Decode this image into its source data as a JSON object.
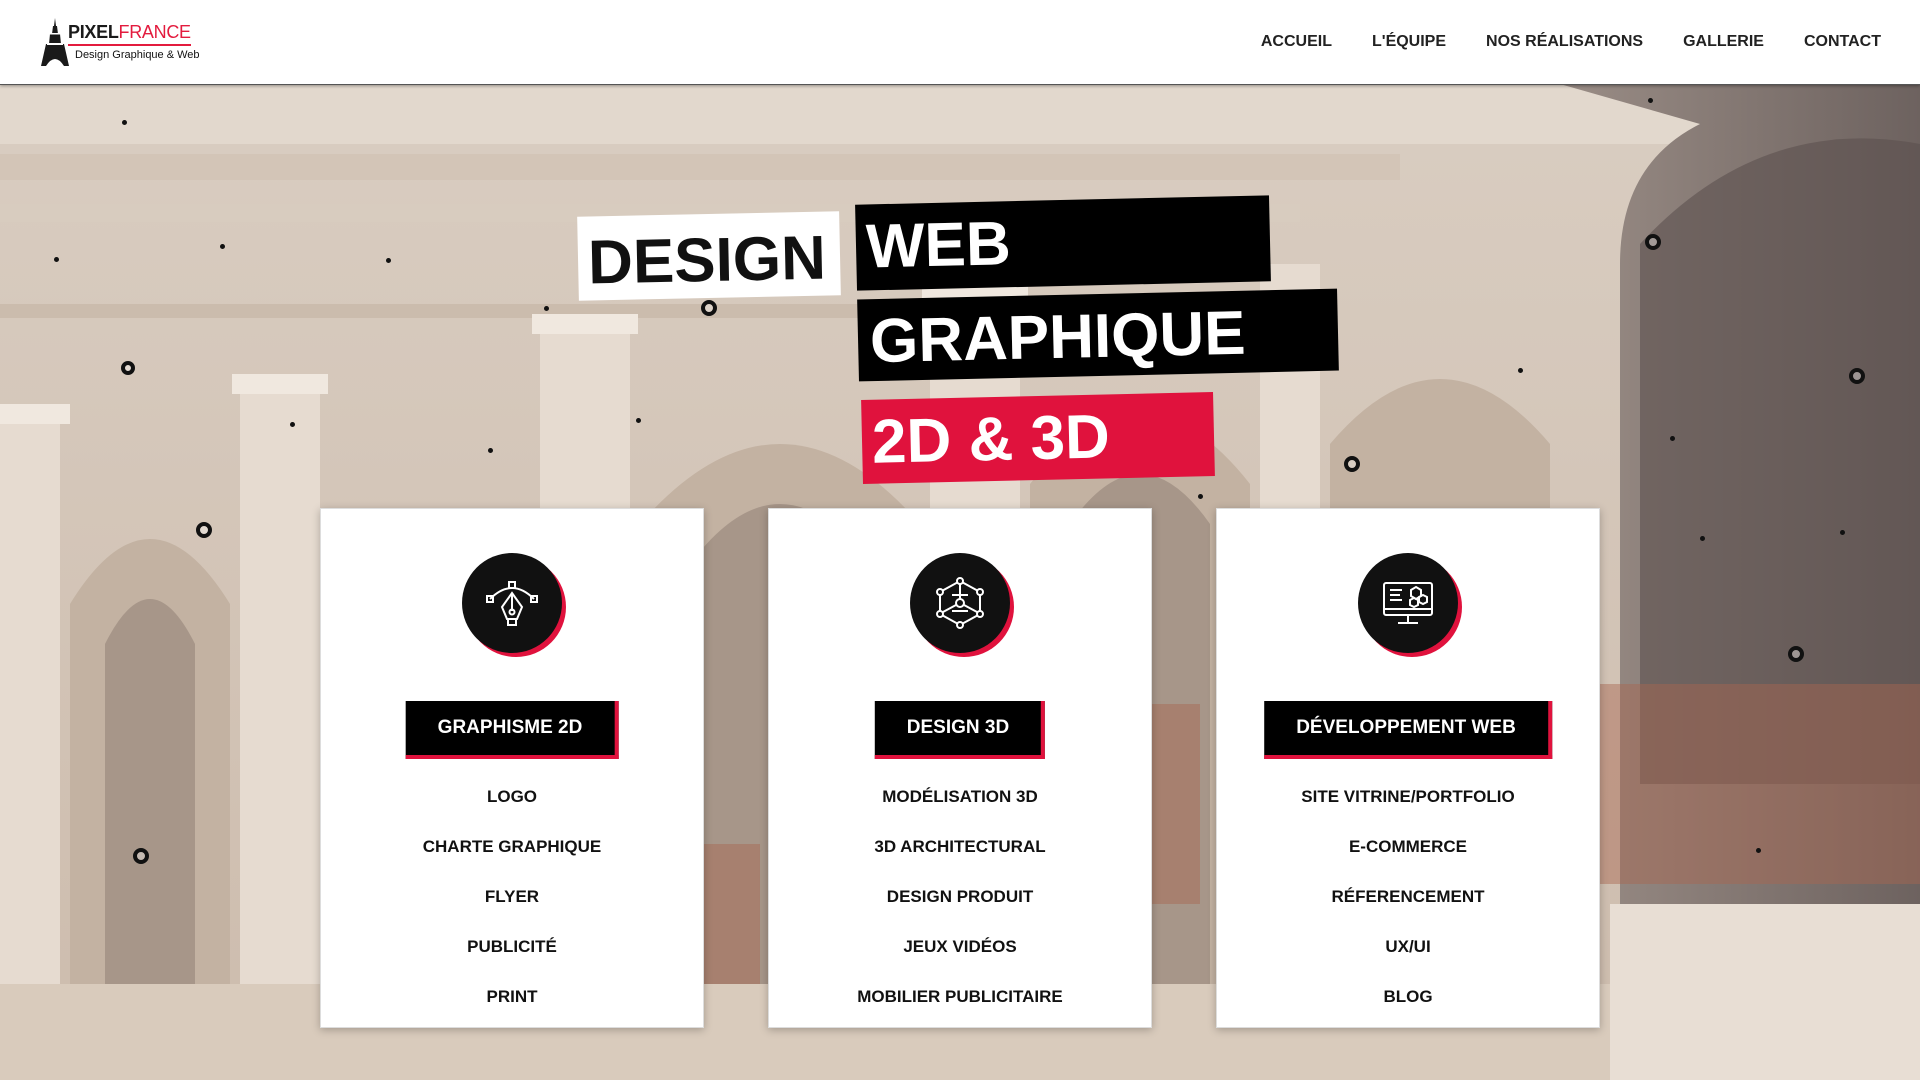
{
  "brand": {
    "name_bold": "PIXEL",
    "name_light": "FRANCE",
    "tagline": "Design Graphique & Web",
    "accent_color": "#e0123d"
  },
  "nav": {
    "items": [
      "ACCUEIL",
      "L'ÉQUIPE",
      "NOS RÉALISATIONS",
      "GALLERIE",
      "CONTACT"
    ]
  },
  "hero": {
    "words": {
      "design": "DESIGN",
      "web": "WEB",
      "graphique": "GRAPHIQUE",
      "dims": "2D & 3D"
    }
  },
  "cards": [
    {
      "icon": "pen-tool-icon",
      "button": "GRAPHISME 2D",
      "items": [
        "LOGO",
        "CHARTE GRAPHIQUE",
        "FLYER",
        "PUBLICITÉ",
        "PRINT"
      ]
    },
    {
      "icon": "3d-network-icon",
      "button": "DESIGN 3D",
      "items": [
        "MODÉLISATION 3D",
        "3D ARCHITECTURAL",
        "DESIGN PRODUIT",
        "JEUX VIDÉOS",
        "MOBILIER PUBLICITAIRE"
      ]
    },
    {
      "icon": "web-monitor-icon",
      "button": "DÉVELOPPEMENT WEB",
      "items": [
        "SITE VITRINE/PORTFOLIO",
        "E-COMMERCE",
        "RÉFERENCEMENT",
        "UX/UI",
        "BLOG"
      ]
    }
  ]
}
